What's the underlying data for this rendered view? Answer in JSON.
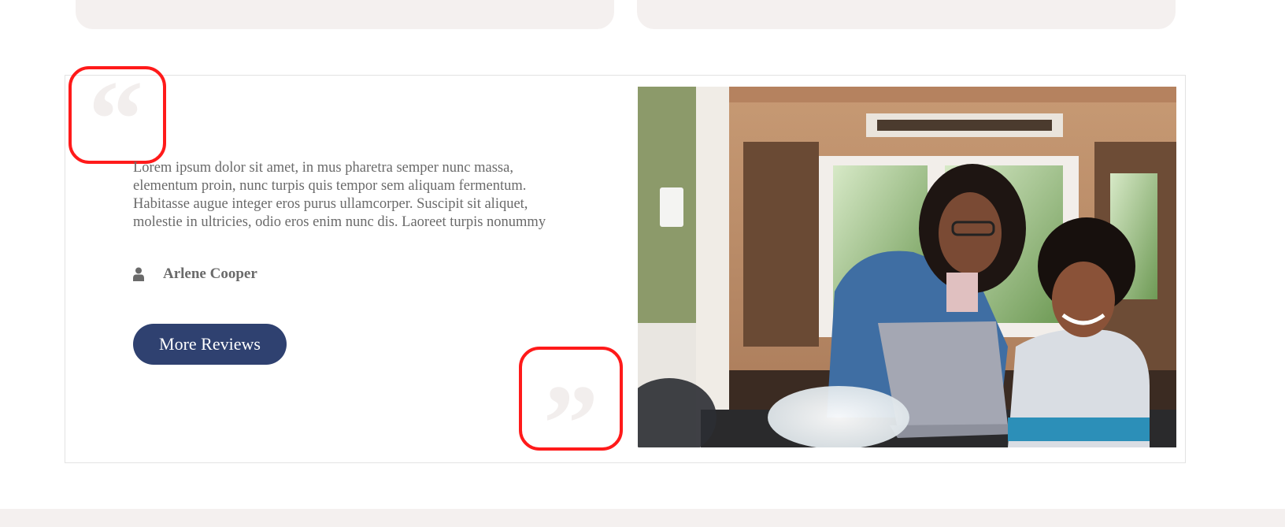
{
  "review": {
    "text": "Lorem ipsum dolor sit amet, in mus pharetra semper nunc massa, elementum proin, nunc turpis quis tempor sem aliquam fermentum. Habitasse augue integer eros purus ullamcorper. Suscipit sit aliquet, molestie in ultricies, odio eros enim nunc dis. Laoreet turpis nonummy",
    "author": "Arlene Cooper",
    "button_label": "More Reviews"
  },
  "colors": {
    "button": "#2f4170",
    "highlight": "#ff1a1a",
    "card_bg": "#f4f0ef",
    "text": "#6a6a6a"
  },
  "icons": {
    "author": "user-icon",
    "open_quote": "open-quote-icon",
    "close_quote": "close-quote-icon"
  }
}
